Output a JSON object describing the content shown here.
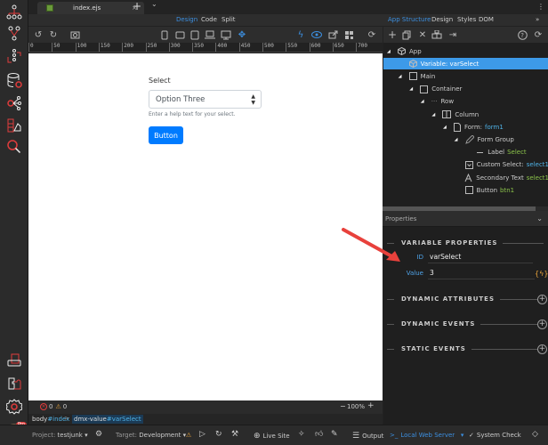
{
  "tabs": {
    "file": "index.ejs",
    "close": "×",
    "add": "+",
    "more": "⌄",
    "menu": "⋮"
  },
  "modes": {
    "design": "Design",
    "code": "Code",
    "split": "Split"
  },
  "right_modes": {
    "app_structure": "App Structure",
    "design": "Design",
    "styles": "Styles",
    "dom": "DOM",
    "expand": "»"
  },
  "ruler": {
    "ticks": [
      "0",
      "50",
      "100",
      "150",
      "200",
      "250",
      "300",
      "350",
      "400",
      "450",
      "500",
      "550",
      "600",
      "650",
      "700"
    ]
  },
  "canvas": {
    "label": "Select",
    "select_value": "Option Three",
    "help_text": "Enter a help text for your select.",
    "button_label": "Button"
  },
  "status": {
    "errors": "0",
    "warnings": "0",
    "zoom": "100%",
    "zoom_minus": "−",
    "zoom_plus": "+"
  },
  "breadcrumb": [
    {
      "key": "body",
      "val": "#index"
    },
    {
      "key": "dmx-value",
      "val": "#varSelect"
    }
  ],
  "breadcrumb_sep": ">",
  "tree": [
    {
      "label": "App",
      "tag": "",
      "tag_color": "",
      "level": 0,
      "expand": true,
      "icon": "cube"
    },
    {
      "label": "Variable: varSelect",
      "tag": "",
      "tag_color": "",
      "level": 1,
      "expand": false,
      "icon": "cube",
      "selected": true
    },
    {
      "label": "Main",
      "tag": "",
      "tag_color": "",
      "level": 1,
      "expand": true,
      "icon": "box"
    },
    {
      "label": "Container",
      "tag": "",
      "tag_color": "",
      "level": 2,
      "expand": true,
      "icon": "box"
    },
    {
      "label": "Row",
      "tag": "",
      "tag_color": "",
      "level": 3,
      "expand": true,
      "icon": "dots"
    },
    {
      "label": "Column",
      "tag": "",
      "tag_color": "",
      "level": 4,
      "expand": true,
      "icon": "columns"
    },
    {
      "label": "Form:",
      "tag": "form1",
      "tag_color": "blue",
      "level": 5,
      "expand": true,
      "icon": "file"
    },
    {
      "label": "Form Group",
      "tag": "",
      "tag_color": "",
      "level": 6,
      "expand": true,
      "icon": "pencil"
    },
    {
      "label": "Label",
      "tag": "Select",
      "tag_color": "green",
      "level": 7,
      "expand": false,
      "icon": "dash"
    },
    {
      "label": "Custom Select:",
      "tag": "select1",
      "tag_color": "blue",
      "level": 7,
      "expand": false,
      "icon": "select"
    },
    {
      "label": "Secondary Text",
      "tag": "select1",
      "tag_color": "green",
      "level": 7,
      "expand": false,
      "icon": "text"
    },
    {
      "label": "Button",
      "tag": "btn1",
      "tag_color": "green",
      "level": 6,
      "expand": false,
      "icon": "box"
    }
  ],
  "properties": {
    "header": "Properties",
    "section_variable": "VARIABLE PROPERTIES",
    "id_label": "ID",
    "id_value": "varSelect",
    "value_label": "Value",
    "value_value": "3",
    "dyn_attrs": "DYNAMIC ATTRIBUTES",
    "dyn_events": "DYNAMIC EVENTS",
    "static_events": "STATIC EVENTS"
  },
  "bottom": {
    "project_label": "Project:",
    "project": "testjunk",
    "target_label": "Target:",
    "target": "Development",
    "live_site": "Live Site",
    "output": "Output",
    "server": "Local Web Server",
    "system_check": "System Check",
    "pro_badge": "Pro"
  },
  "colors": {
    "accent": "#3c8fe0",
    "selected_row": "#3d9ae8",
    "primary_button": "#007bff",
    "sidebar_icon": "#e03c3c",
    "arrow": "#e8413c"
  }
}
